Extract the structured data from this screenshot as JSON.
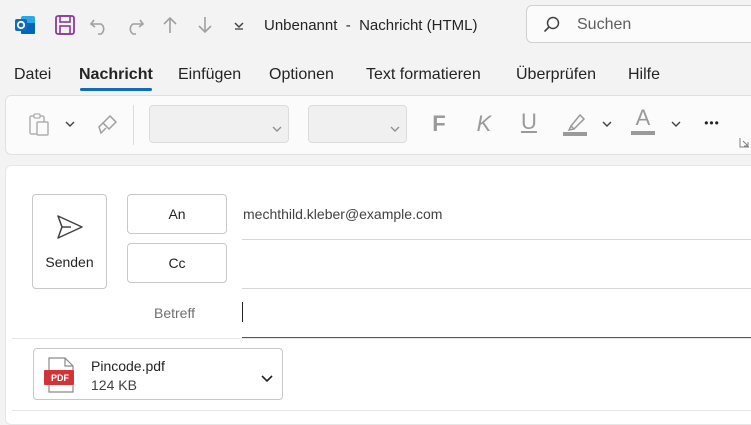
{
  "window": {
    "title_doc": "Unbenannt",
    "title_sep": "-",
    "title_kind": "Nachricht (HTML)"
  },
  "search": {
    "placeholder": "Suchen"
  },
  "tabs": [
    {
      "label": "Datei"
    },
    {
      "label": "Nachricht",
      "active": true
    },
    {
      "label": "Einfügen"
    },
    {
      "label": "Optionen"
    },
    {
      "label": "Text formatieren"
    },
    {
      "label": "Überprüfen"
    },
    {
      "label": "Hilfe"
    }
  ],
  "ribbon": {
    "font_name": "",
    "font_size": "",
    "bold": "F",
    "italic": "K",
    "underline": "U",
    "font_color": "A",
    "more": "•••"
  },
  "compose": {
    "send_label": "Senden",
    "to_label": "An",
    "cc_label": "Cc",
    "subject_label": "Betreff",
    "to_value": "mechthild.kleber@example.com",
    "cc_value": "",
    "subject_value": ""
  },
  "attachment": {
    "name": "Pincode.pdf",
    "size": "124 KB",
    "badge": "PDF"
  },
  "colors": {
    "accent": "#0f6cbd",
    "pdf_red": "#d13438",
    "save_purple": "#8a3a9c",
    "outlook_blue": "#0f6cbd"
  }
}
